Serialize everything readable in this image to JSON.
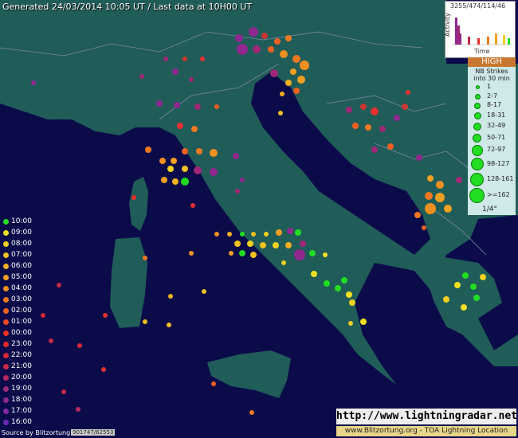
{
  "header": {
    "text": "Generated 24/03/2014 10:05 UT / Last data at 10H00 UT"
  },
  "activity": {
    "counts": "3255/474/114/46",
    "ylabel": "Activity",
    "xlabel": "Time"
  },
  "legend": {
    "high": "HIGH",
    "title_line1": "NB Strikes",
    "title_line2": "into 30 min",
    "items": [
      "1",
      "2-7",
      "8-17",
      "18-31",
      "32-49",
      "50-71",
      "72-97",
      "98-127",
      "128-161",
      ">=162"
    ],
    "grid": "1/4°"
  },
  "time_scale": {
    "labels": [
      "10:00",
      "09:00",
      "08:00",
      "07:00",
      "06:00",
      "05:00",
      "04:00",
      "03:00",
      "02:00",
      "01:00",
      "00:00",
      "23:00",
      "22:00",
      "21:00",
      "20:00",
      "19:00",
      "18:00",
      "17:00",
      "16:00"
    ],
    "colors": [
      "#22dd22",
      "#f0e020",
      "#f0d020",
      "#f0c020",
      "#f0b020",
      "#f0a020",
      "#f09020",
      "#f07820",
      "#f06020",
      "#f04820",
      "#f03020",
      "#e82828",
      "#d82838",
      "#c82848",
      "#b82860",
      "#a02878",
      "#902890",
      "#8028a0",
      "#6828b0"
    ]
  },
  "footer": {
    "source": "Source by Blitzortung",
    "counter": "901747/62553",
    "url": "http://www.lightningradar.net",
    "attribution": "www.Blitzortung.org - TOA Lightning Location"
  },
  "colors": {
    "sea": "#0b0b4a",
    "land": "#205c58",
    "border": "#7a8aa0"
  }
}
